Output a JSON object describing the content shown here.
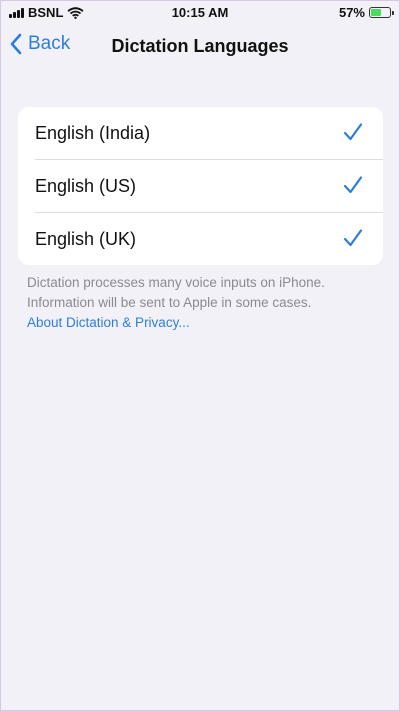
{
  "status_bar": {
    "carrier": "BSNL",
    "time": "10:15 AM",
    "battery_percent": "57%",
    "battery_level": 0.57,
    "icons": [
      "signal-icon",
      "wifi-icon",
      "battery-icon"
    ]
  },
  "nav": {
    "back_label": "Back",
    "title": "Dictation Languages"
  },
  "languages": [
    {
      "label": "English (India)",
      "checked": true
    },
    {
      "label": "English (US)",
      "checked": true
    },
    {
      "label": "English (UK)",
      "checked": true
    }
  ],
  "footer": {
    "line1": "Dictation processes many voice inputs on iPhone.",
    "line2": "Information will be sent to Apple in some cases.",
    "link": "About Dictation & Privacy..."
  },
  "colors": {
    "accent": "#2f7ddb",
    "background": "#f2f1f7",
    "card": "#ffffff",
    "footer_text": "#8a8a90",
    "battery_fill": "#4cd964"
  }
}
